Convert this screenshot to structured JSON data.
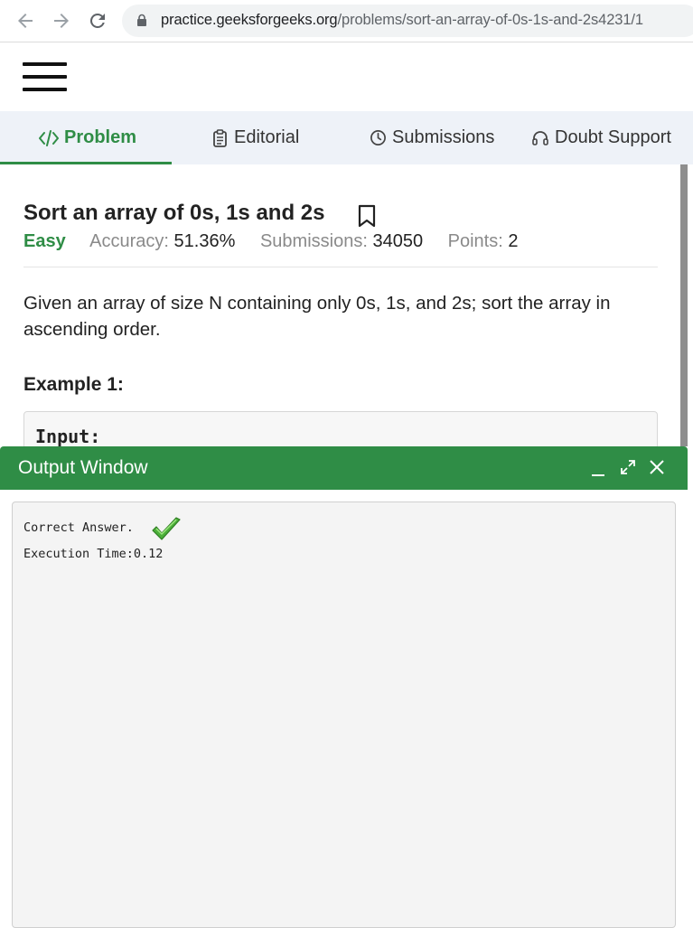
{
  "browser": {
    "url_host": "practice.geeksforgeeks.org",
    "url_path": "/problems/sort-an-array-of-0s-1s-and-2s4231/1"
  },
  "tabs": [
    {
      "label": "Problem",
      "icon": "code-icon",
      "active": true
    },
    {
      "label": "Editorial",
      "icon": "document-icon",
      "active": false
    },
    {
      "label": "Submissions",
      "icon": "clock-icon",
      "active": false
    },
    {
      "label": "Doubt Support",
      "icon": "headset-icon",
      "active": false
    }
  ],
  "problem": {
    "title": "Sort an array of 0s, 1s and 2s",
    "difficulty": "Easy",
    "accuracy_label": "Accuracy:",
    "accuracy_value": "51.36%",
    "submissions_label": "Submissions:",
    "submissions_value": "34050",
    "points_label": "Points:",
    "points_value": "2",
    "description": "Given an array of size N containing only 0s, 1s, and 2s; sort the array in ascending order.",
    "example_title": "Example 1:",
    "example_input_label": "Input:"
  },
  "output_window": {
    "title": "Output Window",
    "result_line": "Correct Answer.",
    "execution_line": "Execution Time:0.12"
  },
  "colors": {
    "brand_green": "#2f8d46",
    "tabs_bg": "#eef2f8",
    "console_bg": "#f4f4f4"
  }
}
